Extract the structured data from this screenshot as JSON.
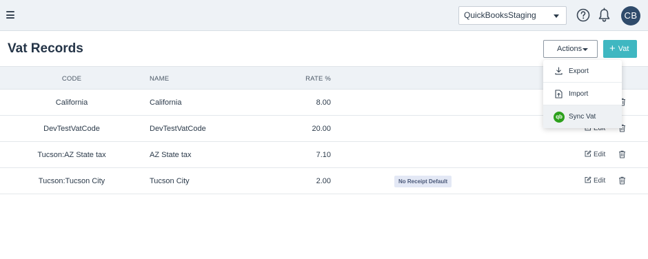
{
  "header": {
    "company_select": "QuickBooksStaging",
    "avatar_initials": "CB"
  },
  "page": {
    "title": "Vat Records",
    "actions_label": "Actions",
    "add_label": "Vat"
  },
  "actions_menu": {
    "items": [
      {
        "label": "Export",
        "icon": "download-icon"
      },
      {
        "label": "Import",
        "icon": "file-upload-icon"
      },
      {
        "label": "Sync Vat",
        "icon": "quickbooks-icon"
      }
    ],
    "qb_logo_text": "qb"
  },
  "table": {
    "columns": [
      "CODE",
      "NAME",
      "RATE %"
    ],
    "edit_label": "Edit",
    "rows": [
      {
        "code": "California",
        "name": "California",
        "rate": "8.00",
        "badge": ""
      },
      {
        "code": "DevTestVatCode",
        "name": "DevTestVatCode",
        "rate": "20.00",
        "badge": ""
      },
      {
        "code": "Tucson:AZ State tax",
        "name": "AZ State tax",
        "rate": "7.10",
        "badge": ""
      },
      {
        "code": "Tucson:Tucson City",
        "name": "Tucson City",
        "rate": "2.00",
        "badge": "No Receipt Default"
      }
    ]
  },
  "colors": {
    "accent": "#3fb7c1",
    "avatar_bg": "#2f4b6b",
    "quickbooks_green": "#2ca01c"
  }
}
